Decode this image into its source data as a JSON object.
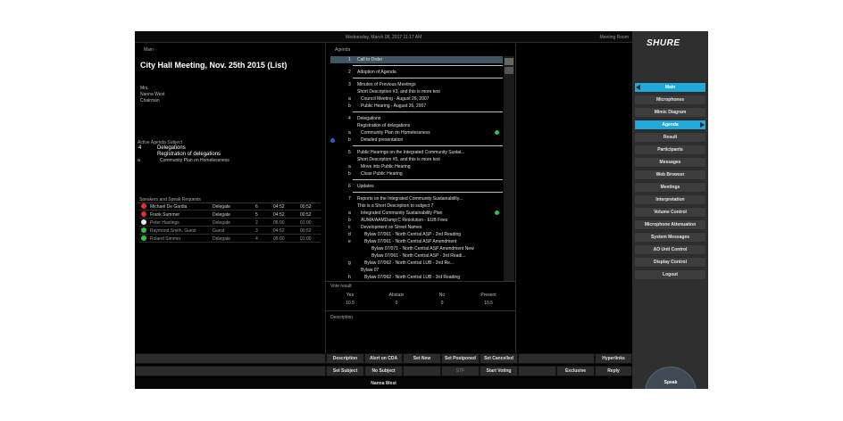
{
  "topbar": {
    "datetime": "Wednesday, March 08, 2017 11:17 AM",
    "room": "Meeting Room"
  },
  "left": {
    "panel_label": "Main",
    "meeting_title": "City Hall Meeting, Nov. 25th 2015 (List)",
    "person": [
      "Mrs.",
      "Nanna West",
      "Chairman"
    ],
    "active_label": "Active Agenda Subject",
    "active_number": "4",
    "active_title": "Delegations",
    "active_subtitle": "Registration of delegations",
    "active_item_letter": "a",
    "active_item": "Community Plan on Homelessness",
    "speakers_label": "Speakers and Speak Requests",
    "speakers": [
      {
        "name": "Michael De Gardia",
        "role": "Delegate",
        "seat": "6",
        "t1": "04:52",
        "t2": "00:52",
        "color": "#e03030"
      },
      {
        "name": "Frank Summer",
        "role": "Delegate",
        "seat": "5",
        "t1": "04:52",
        "t2": "00:52",
        "color": "#e03030"
      },
      {
        "name": "Peter Hastings",
        "role": "Delegate",
        "seat": "2",
        "t1": "05:00",
        "t2": "01:00",
        "color": "#e8e8e8"
      },
      {
        "name": "Raymond Smith, Guest",
        "role": "Guest",
        "seat": "3",
        "t1": "04:52",
        "t2": "00:52",
        "color": "#2ec24a"
      },
      {
        "name": "Roland  Simmer",
        "role": "Delegate",
        "seat": "4",
        "t1": "05:00",
        "t2": "01:00",
        "color": "#2ec24a"
      }
    ]
  },
  "agenda": {
    "panel_label": "Agenda",
    "rows": [
      {
        "num": "1",
        "text": "Call to Order",
        "indent": 0,
        "sel": true
      },
      {
        "num": "2",
        "text": "Adoption of Agenda",
        "indent": 0
      },
      {
        "num": "3",
        "text": "Minutes of Previous Meetings",
        "indent": 0
      },
      {
        "num": "",
        "text": "Short Description #3, and this is more text",
        "indent": 0
      },
      {
        "num": "a",
        "text": "Council Meeting - August 26, 2007",
        "indent": 1
      },
      {
        "num": "b",
        "text": "Public Hearing - August 26, 2007",
        "indent": 1
      },
      {
        "num": "4",
        "text": "Delegations",
        "indent": 0
      },
      {
        "num": "",
        "text": "Registration of delegations",
        "indent": 0
      },
      {
        "num": "a",
        "text": "Community Plan on Homelessness",
        "indent": 1
      },
      {
        "num": "b",
        "text": "Detailed presentation",
        "indent": 1
      },
      {
        "num": "5",
        "text": "Public Hearings on the Integrated Community Sustai...",
        "indent": 0
      },
      {
        "num": "",
        "text": "Short Description #5, and this is more text",
        "indent": 0
      },
      {
        "num": "a",
        "text": "Move into Public Hearing",
        "indent": 1
      },
      {
        "num": "b",
        "text": "Close Public Hearing",
        "indent": 1
      },
      {
        "num": "6",
        "text": "Updates",
        "indent": 0
      },
      {
        "num": "7",
        "text": "Reports on the Integrated Community Sustainability...",
        "indent": 0
      },
      {
        "num": "",
        "text": "This is a Short Description to subject 7",
        "indent": 0
      },
      {
        "num": "a",
        "text": "Integrated Community Sustainability Plan",
        "indent": 1
      },
      {
        "num": "b",
        "text": "AUMA/AAMDamp;C Resolution - EUB Fees",
        "indent": 1
      },
      {
        "num": "c",
        "text": "Development on Street Names",
        "indent": 1
      },
      {
        "num": "d",
        "text": "Bylaw 07/061 - North Central ASP - 2nd Reading",
        "indent": 2
      },
      {
        "num": "e",
        "text": "Bylaw 07/061 - North Central ASP Amendment",
        "indent": 2
      },
      {
        "num": "",
        "text": "Bylaw 07/071 - North Central ASP Amendment      New",
        "indent": 3
      },
      {
        "num": "",
        "text": "Bylaw 07/061 - North Central ASP - 3rd Readi...",
        "indent": 3
      },
      {
        "num": "g",
        "text": "Bylaw 07/062 - North Central LUB - 2nd Re...",
        "indent": 2
      },
      {
        "num": "",
        "text": "Bylaw 07",
        "indent": 1
      },
      {
        "num": "h",
        "text": "Bylaw 07/062 - North Central LUB - 3rd Reading",
        "indent": 2
      },
      {
        "num": "i",
        "text": "Bylaw 07/063 - Red Creek Area LUB - 2nd Reading",
        "indent": 2
      },
      {
        "num": "",
        "text": "Bylaw 07/063 - Red Creek Area LUB - 3rd Reading",
        "indent": 2
      }
    ],
    "vote_label": "Vote result",
    "vote_headers": [
      "Yes",
      "Abstain",
      "No",
      "Present"
    ],
    "vote_values": [
      "10.5",
      "0",
      "0",
      "10.5"
    ],
    "description_label": "Description"
  },
  "buttons_row1": [
    "Description",
    "Alert on CDA",
    "Set New",
    "Set Postponed",
    "Set Cancelled",
    "Hyperlinks"
  ],
  "buttons_row2": [
    "Set Subject",
    "No Subject",
    "STF",
    "Start Voting",
    "Exclusive",
    "Reply"
  ],
  "status_name": "Nanna West",
  "brand": "SHURE",
  "menu": [
    "Main",
    "Microphones",
    "Mimic Diagram",
    "Agenda",
    "Result",
    "Participants",
    "Messages",
    "Web Browser",
    "Meetings",
    "Interpretation",
    "Volume Control",
    "Microphone Attenuation",
    "System Messages",
    "AO Unit Control",
    "Display Control",
    "Logout"
  ],
  "speak_label": "Speak",
  "accent": "#1fa8d8"
}
